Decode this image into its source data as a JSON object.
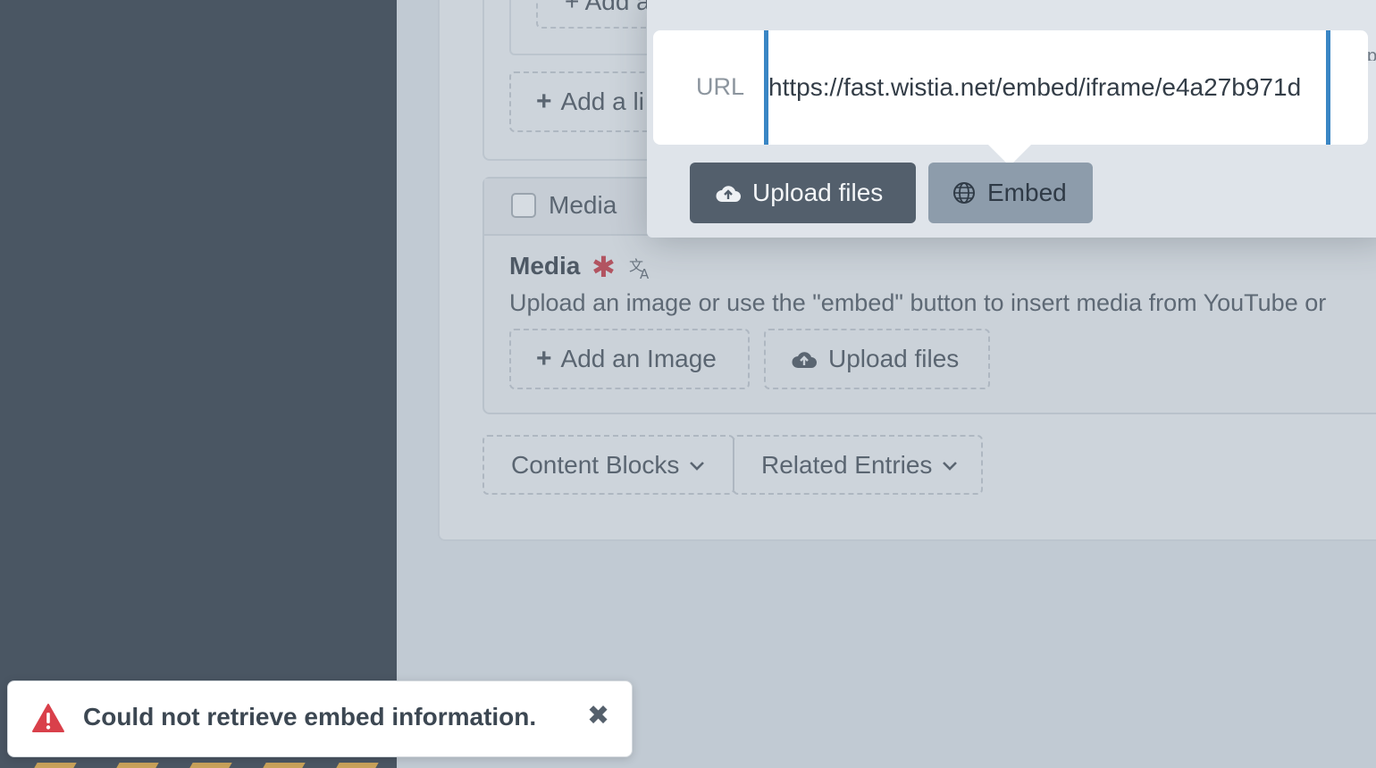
{
  "colors": {
    "sidebar": "#4a5663",
    "accent_input_border": "#3a86c4",
    "upload_button": "#535f6c",
    "embed_button": "#8d9cab",
    "required_star": "#b25461",
    "toast_warning": "#d9404a"
  },
  "background_form": {
    "prev_add_top_label": "+ Add a",
    "prev_add_link_label": "Add a li",
    "media_block_header": "Media",
    "media_field_label": "Media",
    "media_field_help": "Upload an image or use the \"embed\" button to insert media from YouTube or",
    "add_image_label": "Add an Image",
    "upload_files_label": "Upload files",
    "content_blocks_label": "Content Blocks",
    "related_entries_label": "Related Entries"
  },
  "embed_popover": {
    "url_label": "URL",
    "url_value": "https://fast.wistia.net/embed/iframe/e4a27b971d",
    "upload_files_label": "Upload files",
    "embed_label": "Embed"
  },
  "toast": {
    "message": "Could not retrieve embed information.",
    "close_symbol": "✖"
  },
  "icons": [
    "upload-cloud-icon",
    "globe-icon",
    "translate-icon",
    "warning-icon",
    "close-icon",
    "plus-icon",
    "chevron-down-icon"
  ]
}
